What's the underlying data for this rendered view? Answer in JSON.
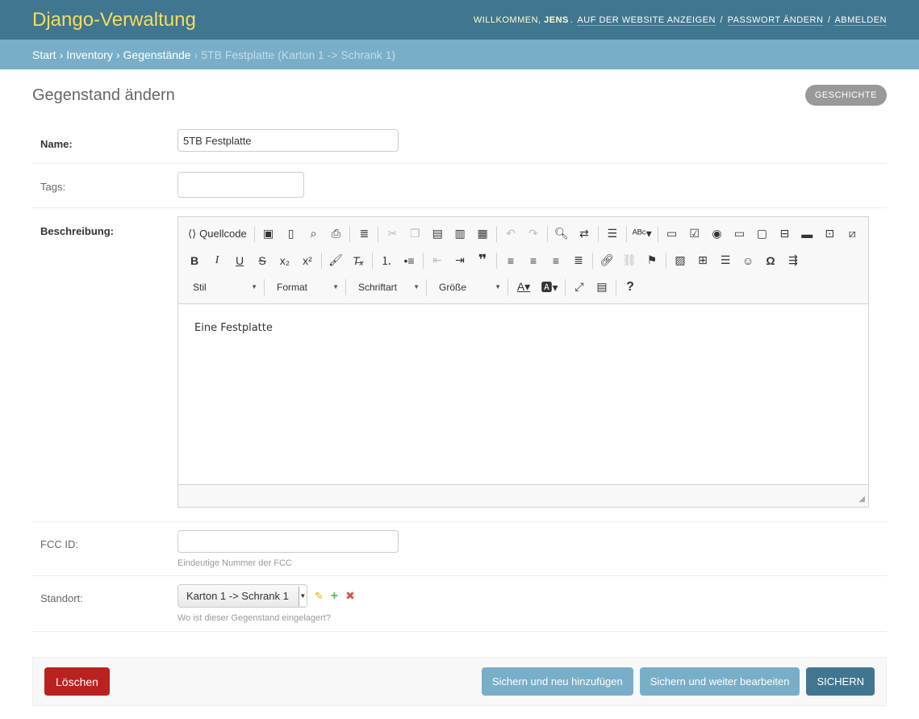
{
  "header": {
    "brand": "Django-Verwaltung",
    "welcome": "Willkommen,",
    "username": "Jens",
    "view_site": "Auf der Website anzeigen",
    "change_password": "Passwort ändern",
    "logout": "Abmelden"
  },
  "breadcrumbs": {
    "home": "Start",
    "app": "Inventory",
    "model": "Gegenstände",
    "current": "5TB Festplatte (Karton 1 -> Schrank 1)"
  },
  "page": {
    "title": "Gegenstand ändern",
    "history": "Geschichte"
  },
  "fields": {
    "name": {
      "label": "Name:",
      "value": "5TB Festplatte"
    },
    "tags": {
      "label": "Tags:",
      "value": ""
    },
    "description": {
      "label": "Beschreibung:",
      "content": "Eine Festplatte"
    },
    "fcc": {
      "label": "FCC ID:",
      "value": "",
      "help": "Eindeutige Nummer der FCC"
    },
    "location": {
      "label": "Standort:",
      "selected": "Karton 1 -> Schrank 1",
      "help": "Wo ist dieser Gegenstand eingelagert?"
    }
  },
  "editor": {
    "source_label": "Quellcode",
    "combos": [
      "Stil",
      "Format",
      "Schriftart",
      "Größe"
    ]
  },
  "buttons": {
    "delete": "Löschen",
    "save_add": "Sichern und neu hinzufügen",
    "save_continue": "Sichern und weiter bearbeiten",
    "save": "Sichern"
  },
  "colors": {
    "header": "#417690",
    "breadcrumbs": "#79aec8",
    "brand": "#f5dd5d",
    "delete": "#ba2121"
  }
}
